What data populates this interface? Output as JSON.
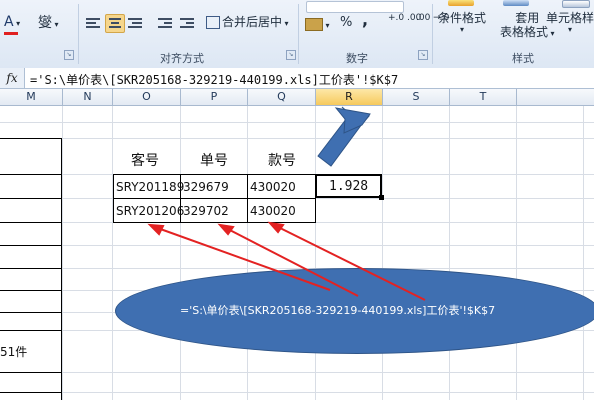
{
  "ribbon": {
    "font_color_label": "A",
    "phonetic_label": "燮",
    "merge_center_label": "合并后居中",
    "alignment_group_label": "对齐方式",
    "number_group_label": "数字",
    "percent_label": "%",
    "comma_label": ",",
    "inc_decimal_label": "+.0 .00",
    "dec_decimal_label": ".00 →.0",
    "conditional_format_label": "条件格式",
    "table_format_label_1": "套用",
    "table_format_label_2": "表格格式",
    "cell_style_label": "单元格样式",
    "style_group_label": "样式"
  },
  "formula_bar": {
    "fx_label": "fx",
    "formula": "='S:\\单价表\\[SKR205168-329219-440199.xls]工价表'!$K$7"
  },
  "columns": [
    "M",
    "N",
    "O",
    "P",
    "Q",
    "R",
    "S",
    "T"
  ],
  "selected_column": "Q",
  "table": {
    "headers": [
      "客号",
      "单号",
      "款号"
    ],
    "rows": [
      [
        "SRY201189",
        "329679",
        "430020"
      ],
      [
        "SRY201206",
        "329702",
        "430020"
      ]
    ]
  },
  "selected_cell_value": "1.928",
  "left_cell_partial_text": "51件",
  "annotation": {
    "ellipse_text": "='S:\\单价表\\[SKR205168-329219-440199.xls]工价表'!$K$7",
    "ellipse_color": "#3f6fb1",
    "arrow_color": "#3f6fb1",
    "pointer_color": "#e32222"
  }
}
